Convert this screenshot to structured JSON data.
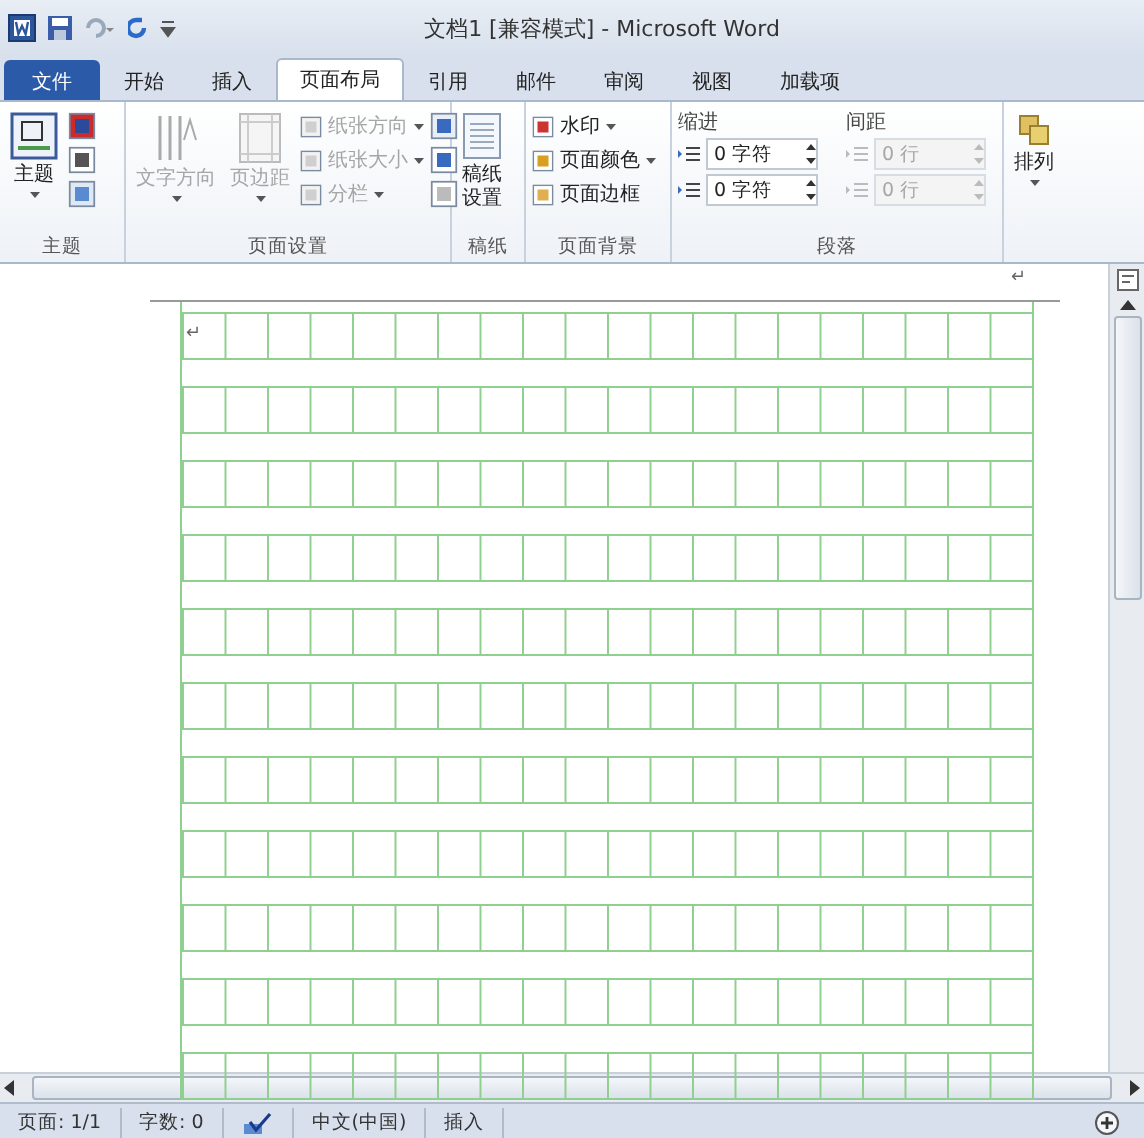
{
  "window": {
    "title": "文档1 [兼容模式] - Microsoft Word"
  },
  "tabs": [
    {
      "label": "文件",
      "kind": "file",
      "selected": false
    },
    {
      "label": "开始",
      "kind": "tab",
      "selected": false
    },
    {
      "label": "插入",
      "kind": "tab",
      "selected": false
    },
    {
      "label": "页面布局",
      "kind": "tab",
      "selected": true
    },
    {
      "label": "引用",
      "kind": "tab",
      "selected": false
    },
    {
      "label": "邮件",
      "kind": "tab",
      "selected": false
    },
    {
      "label": "审阅",
      "kind": "tab",
      "selected": false
    },
    {
      "label": "视图",
      "kind": "tab",
      "selected": false
    },
    {
      "label": "加载项",
      "kind": "tab",
      "selected": false
    }
  ],
  "ribbon": {
    "theme": {
      "label": "主题",
      "button": "主题"
    },
    "page_setup": {
      "label": "页面设置",
      "large": [
        {
          "label": "文字方向",
          "disabled": true
        },
        {
          "label": "页边距",
          "disabled": true
        }
      ],
      "small": [
        {
          "label": "纸张方向",
          "disabled": true
        },
        {
          "label": "纸张大小",
          "disabled": true
        },
        {
          "label": "分栏",
          "disabled": true
        }
      ]
    },
    "manuscript": {
      "label": "稿纸",
      "button": "稿纸设置"
    },
    "background": {
      "label": "页面背景",
      "items": [
        {
          "label": "水印",
          "dropdown": true
        },
        {
          "label": "页面颜色",
          "dropdown": true
        },
        {
          "label": "页面边框",
          "dropdown": false
        }
      ]
    },
    "paragraph": {
      "label": "段落",
      "indent": {
        "title": "缩进",
        "fields": [
          {
            "value": "0 字符",
            "disabled": false
          },
          {
            "value": "0 字符",
            "disabled": false
          }
        ]
      },
      "spacing": {
        "title": "间距",
        "fields": [
          {
            "value": "0 行",
            "disabled": true
          },
          {
            "value": "0 行",
            "disabled": true
          }
        ]
      }
    },
    "arrange": {
      "button": "排列"
    }
  },
  "document": {
    "header_mark": "↵",
    "paragraph_mark": "↵"
  },
  "status_bar": [
    {
      "text": "页面: 1/1",
      "kind": "text"
    },
    {
      "text": "字数: 0",
      "kind": "text"
    },
    {
      "kind": "proofing"
    },
    {
      "text": "中文(中国)",
      "kind": "text"
    },
    {
      "text": "插入",
      "kind": "text"
    }
  ]
}
